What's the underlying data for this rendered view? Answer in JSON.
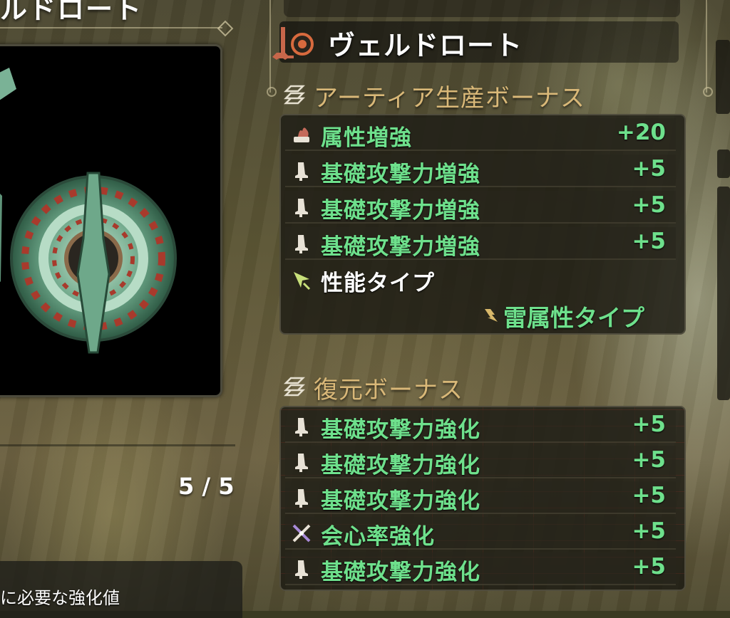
{
  "left": {
    "title": "ルドロート",
    "progress": "5 / 5",
    "footer": "に必要な強化値"
  },
  "weapon": {
    "name": "ヴェルドロート",
    "icon": "weapon-icon"
  },
  "artia_bonus": {
    "title": "アーティア生産ボーナス",
    "rows": [
      {
        "label": "属性増強",
        "value": "+20",
        "icon": "element-icon"
      },
      {
        "label": "基礎攻撃力増強",
        "value": "+5",
        "icon": "attack-icon"
      },
      {
        "label": "基礎攻撃力増強",
        "value": "+5",
        "icon": "attack-icon"
      },
      {
        "label": "基礎攻撃力増強",
        "value": "+5",
        "icon": "attack-icon"
      }
    ],
    "type_label": "性能タイプ",
    "type_value": "雷属性タイプ"
  },
  "restore_bonus": {
    "title": "復元ボーナス",
    "rows": [
      {
        "label": "基礎攻撃力強化",
        "value": "+5",
        "icon": "attack-icon"
      },
      {
        "label": "基礎攻撃力強化",
        "value": "+5",
        "icon": "attack-icon"
      },
      {
        "label": "基礎攻撃力強化",
        "value": "+5",
        "icon": "attack-icon"
      },
      {
        "label": "会心率強化",
        "value": "+5",
        "icon": "affinity-icon"
      },
      {
        "label": "基礎攻撃力強化",
        "value": "+5",
        "icon": "attack-icon"
      }
    ]
  },
  "colors": {
    "value_green": "#6ee08c",
    "section_gold": "#d9b878"
  }
}
